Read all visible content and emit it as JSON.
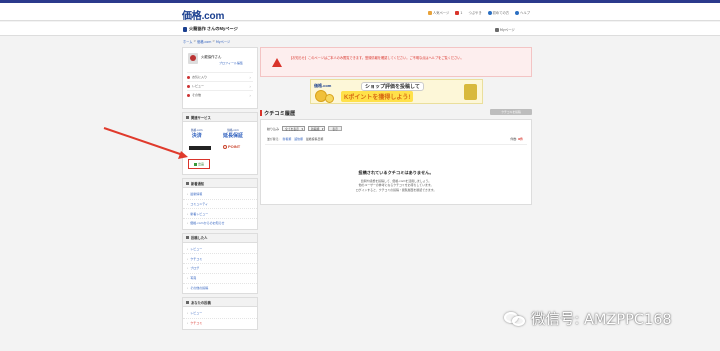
{
  "header": {
    "logo": "価格.com",
    "links": [
      "人気ページ",
      "1",
      "つぶやき",
      "初めての方",
      "ヘルプ"
    ]
  },
  "subbar": {
    "user_title": "火龍協作 さんのMyページ",
    "mypage_link": "Myページ"
  },
  "breadcrumb": [
    "ホーム",
    "価格.com",
    "Myページ"
  ],
  "profile": {
    "name": "火龍協作さん",
    "link": "プロフィール編集",
    "menu": [
      "お気に入り",
      "レビュー",
      "その他"
    ]
  },
  "services": {
    "heading": "関連サービス",
    "svc_a_small": "価格.com",
    "svc_a_main": "決済",
    "svc_b_small": "価格.com",
    "svc_b_main": "延長保証",
    "svc_d": "POINT",
    "sell_button": "出品"
  },
  "section_news": {
    "heading": "新着通知",
    "items": [
      "最新情報",
      "コミュニティ",
      "新着レビュー",
      "価格.comからのお知らせ"
    ]
  },
  "section_posts": {
    "heading": "投稿した人",
    "items": [
      "レビュー",
      "クチコミ",
      "ブログ",
      "写真",
      "その他の投稿"
    ]
  },
  "section_mine": {
    "heading": "あなたの投稿",
    "items": [
      "レビュー",
      "クチコミ"
    ]
  },
  "notice": {
    "text": "【お知らせ】このページはご本人のみ閲覧できます。登録情報を確認してください。ご不明な点はヘルプをご覧ください。"
  },
  "banner": {
    "kakaku": "価格.com",
    "line1": "ショップ評価を投稿して",
    "line2": "Kポイントを獲得しよう!"
  },
  "kuchikomi": {
    "title": "クチコミ履歴",
    "new_button": "クチコミを投稿",
    "filter_label": "絞り込み",
    "select1": "全てを表示",
    "select2": "新着順",
    "go_button": "表示",
    "sort_label": "並び替え:",
    "sort_links": [
      "新着順",
      "返信順"
    ],
    "sort_extra": "最終投稿日順",
    "count_label": "件数:",
    "count_value": "0件",
    "empty_title": "投稿されているクチコミはありません。",
    "empty_lines": [
      "質問や感想を投稿して、価格.comを活用しましょう。",
      "他のユーザーの参考になるクチコミをお待ちしています。",
      "ログインすると、クチコミの投稿・閲覧履歴を確認できます。"
    ]
  },
  "watermark": "微信号: AMZPPC168",
  "colors": {
    "brand": "#1a3f8f",
    "accent_red": "#d9342b",
    "link": "#2b5dbd"
  }
}
